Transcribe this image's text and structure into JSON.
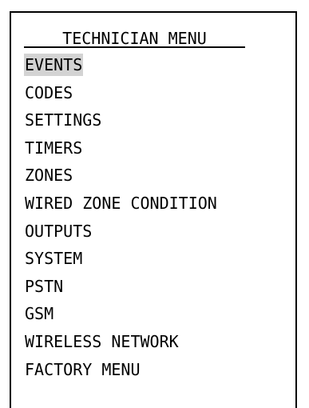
{
  "menu": {
    "title": "    TECHNICIAN MENU____",
    "selected_index": 0,
    "items": [
      {
        "label": "EVENTS"
      },
      {
        "label": "CODES"
      },
      {
        "label": "SETTINGS"
      },
      {
        "label": "TIMERS"
      },
      {
        "label": "ZONES"
      },
      {
        "label": "WIRED ZONE CONDITION"
      },
      {
        "label": "OUTPUTS"
      },
      {
        "label": "SYSTEM"
      },
      {
        "label": "PSTN"
      },
      {
        "label": "GSM"
      },
      {
        "label": "WIRELESS NETWORK"
      },
      {
        "label": "FACTORY MENU"
      }
    ]
  },
  "colors": {
    "highlight": "#d3d3d3",
    "text": "#000000",
    "background": "#ffffff",
    "border": "#000000"
  }
}
